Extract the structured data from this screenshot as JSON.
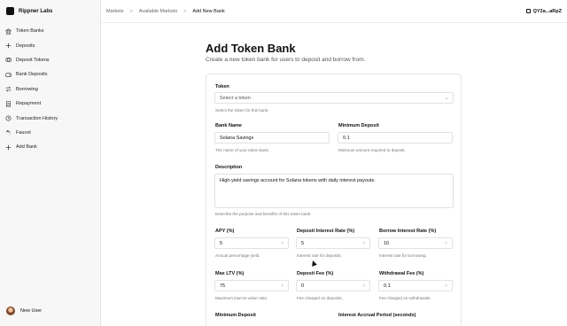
{
  "brand": {
    "name": "Rippner Labs"
  },
  "sidebar": {
    "items": [
      {
        "label": "Token Banks",
        "icon": "bank-icon"
      },
      {
        "label": "Deposits",
        "icon": "plus-icon"
      },
      {
        "label": "Deposit Tokens",
        "icon": "coins-icon"
      },
      {
        "label": "Bank Deposits",
        "icon": "wallet-icon"
      },
      {
        "label": "Borrowing",
        "icon": "arrows-icon"
      },
      {
        "label": "Repayment",
        "icon": "receipt-icon"
      },
      {
        "label": "Transaction History",
        "icon": "history-icon"
      },
      {
        "label": "Faucet",
        "icon": "faucet-icon"
      },
      {
        "label": "Add Bank",
        "icon": "plus-icon"
      }
    ],
    "user": {
      "name": "New User"
    }
  },
  "breadcrumb": {
    "items": [
      "Markets",
      "Available Markets",
      "Add New Bank"
    ]
  },
  "wallet": {
    "address": "QY2a...aRpZ"
  },
  "page": {
    "title": "Add Token Bank",
    "subtitle": "Create a new token bank for users to deposit and borrow from."
  },
  "form": {
    "token": {
      "label": "Token",
      "placeholder": "Select a token",
      "hint": "Select the token for this bank."
    },
    "bank_name": {
      "label": "Bank Name",
      "value": "Solana Savings",
      "hint": "The name of your token bank."
    },
    "min_deposit": {
      "label": "Minimum Deposit",
      "value": "0.1",
      "hint": "Minimum amount required to deposit."
    },
    "description": {
      "label": "Description",
      "value": "High-yield savings account for Solana tokens with daily interest payouts.",
      "hint": "Describe the purpose and benefits of this token bank."
    },
    "apy": {
      "label": "APY (%)",
      "value": "5",
      "hint": "Annual percentage yield."
    },
    "deposit_rate": {
      "label": "Deposit Interest Rate (%)",
      "value": "5",
      "hint": "Interest rate for deposits."
    },
    "borrow_rate": {
      "label": "Borrow Interest Rate (%)",
      "value": "10",
      "hint": "Interest rate for borrowing."
    },
    "max_ltv": {
      "label": "Max LTV (%)",
      "value": "75",
      "hint": "Maximum loan-to-value ratio."
    },
    "deposit_fee": {
      "label": "Deposit Fee (%)",
      "value": "0",
      "hint": "Fee charged on deposits."
    },
    "withdrawal_fee": {
      "label": "Withdrawal Fee (%)",
      "value": "0.1",
      "hint": "Fee charged on withdrawals."
    },
    "minimum_deposit2": {
      "label": "Minimum Deposit"
    },
    "accrual_period": {
      "label": "Interest Accrual Period (seconds)"
    }
  }
}
